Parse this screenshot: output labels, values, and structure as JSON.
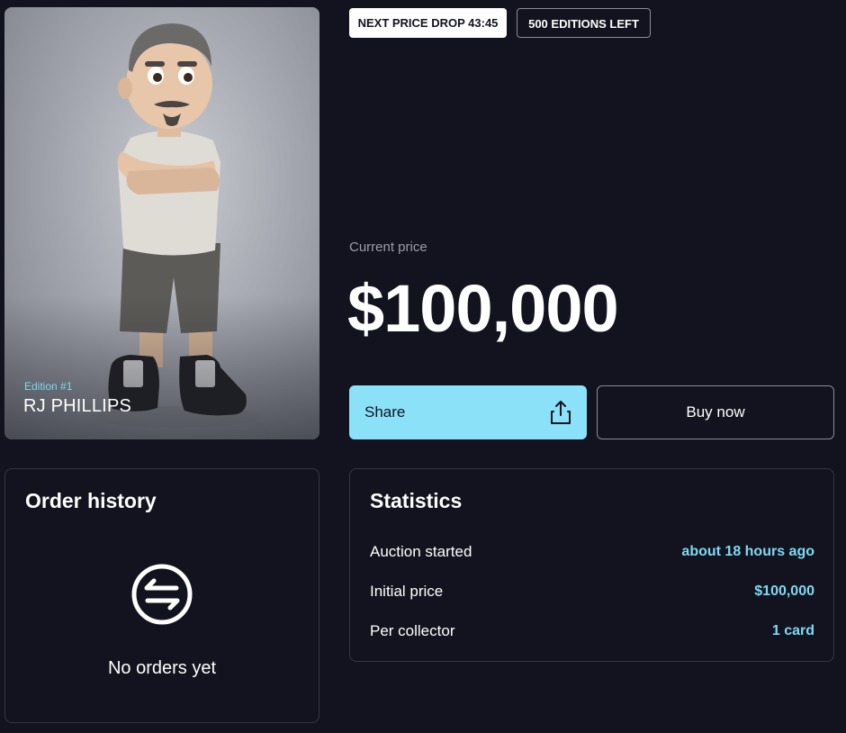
{
  "card": {
    "edition": "Edition #1",
    "name": "RJ PHILLIPS"
  },
  "badges": {
    "price_drop_label": "NEXT PRICE DROP  43:45",
    "editions_left": "500 EDITIONS LEFT"
  },
  "price": {
    "label": "Current price",
    "value": "$100,000"
  },
  "actions": {
    "share_label": "Share",
    "buy_label": "Buy now"
  },
  "order_history": {
    "title": "Order history",
    "empty_text": "No orders yet",
    "icon": "swap-arrows-icon"
  },
  "statistics": {
    "title": "Statistics",
    "rows": [
      {
        "label": "Auction started",
        "value": "about 18 hours ago"
      },
      {
        "label": "Initial price",
        "value": "$100,000"
      },
      {
        "label": "Per collector",
        "value": "1 card"
      }
    ]
  },
  "colors": {
    "background": "#12131f",
    "accent": "#8be2f8",
    "accent_text": "#7fd9f3",
    "border": "#34363f"
  }
}
